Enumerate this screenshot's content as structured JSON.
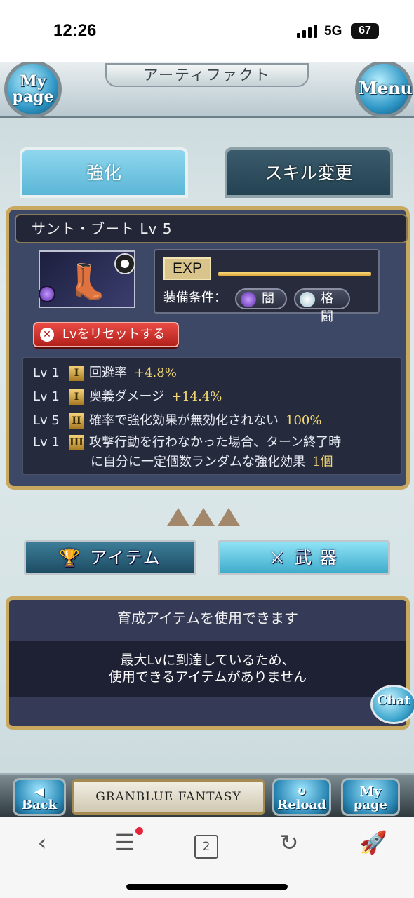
{
  "status": {
    "time": "12:26",
    "network": "5G",
    "battery": "67"
  },
  "header": {
    "title": "アーティファクト",
    "mypage": [
      "My",
      "page"
    ],
    "menu": "Menu"
  },
  "tabs": [
    {
      "label": "強化",
      "active": true
    },
    {
      "label": "スキル変更",
      "active": false
    }
  ],
  "artifact": {
    "name": "サント・ブート Lv 5",
    "exp_label": "EXP",
    "equip_label": "装備条件：",
    "conditions": [
      "闇",
      "格闘"
    ],
    "reset_label": "Lvをリセットする"
  },
  "skills": [
    {
      "lv": "Lv 1",
      "tier": "I",
      "text": "回避率",
      "value": "+4.8%"
    },
    {
      "lv": "Lv 1",
      "tier": "I",
      "text": "奥義ダメージ",
      "value": "+14.4%"
    },
    {
      "lv": "Lv 5",
      "tier": "II",
      "text": "確率で強化効果が無効化されない",
      "value": "100%"
    },
    {
      "lv": "Lv 1",
      "tier": "III",
      "text": "攻撃行動を行わなかった場合、ターン終了時",
      "text2": "に自分に一定個数ランダムな強化効果",
      "value": "1個"
    }
  ],
  "buttons": {
    "item": "アイテム",
    "weapon": "武 器"
  },
  "message": {
    "head": "育成アイテムを使用できます",
    "line1": "最大Lvに到達しているため、",
    "line2": "使用できるアイテムがありません"
  },
  "chat": "Chat",
  "bottom": {
    "back": [
      "◀",
      "Back"
    ],
    "logo": "GRANBLUE FANTASY",
    "reload": [
      "↻",
      "Reload"
    ],
    "mypage": [
      "My",
      "page"
    ]
  },
  "browser": {
    "tabs_count": "2"
  }
}
